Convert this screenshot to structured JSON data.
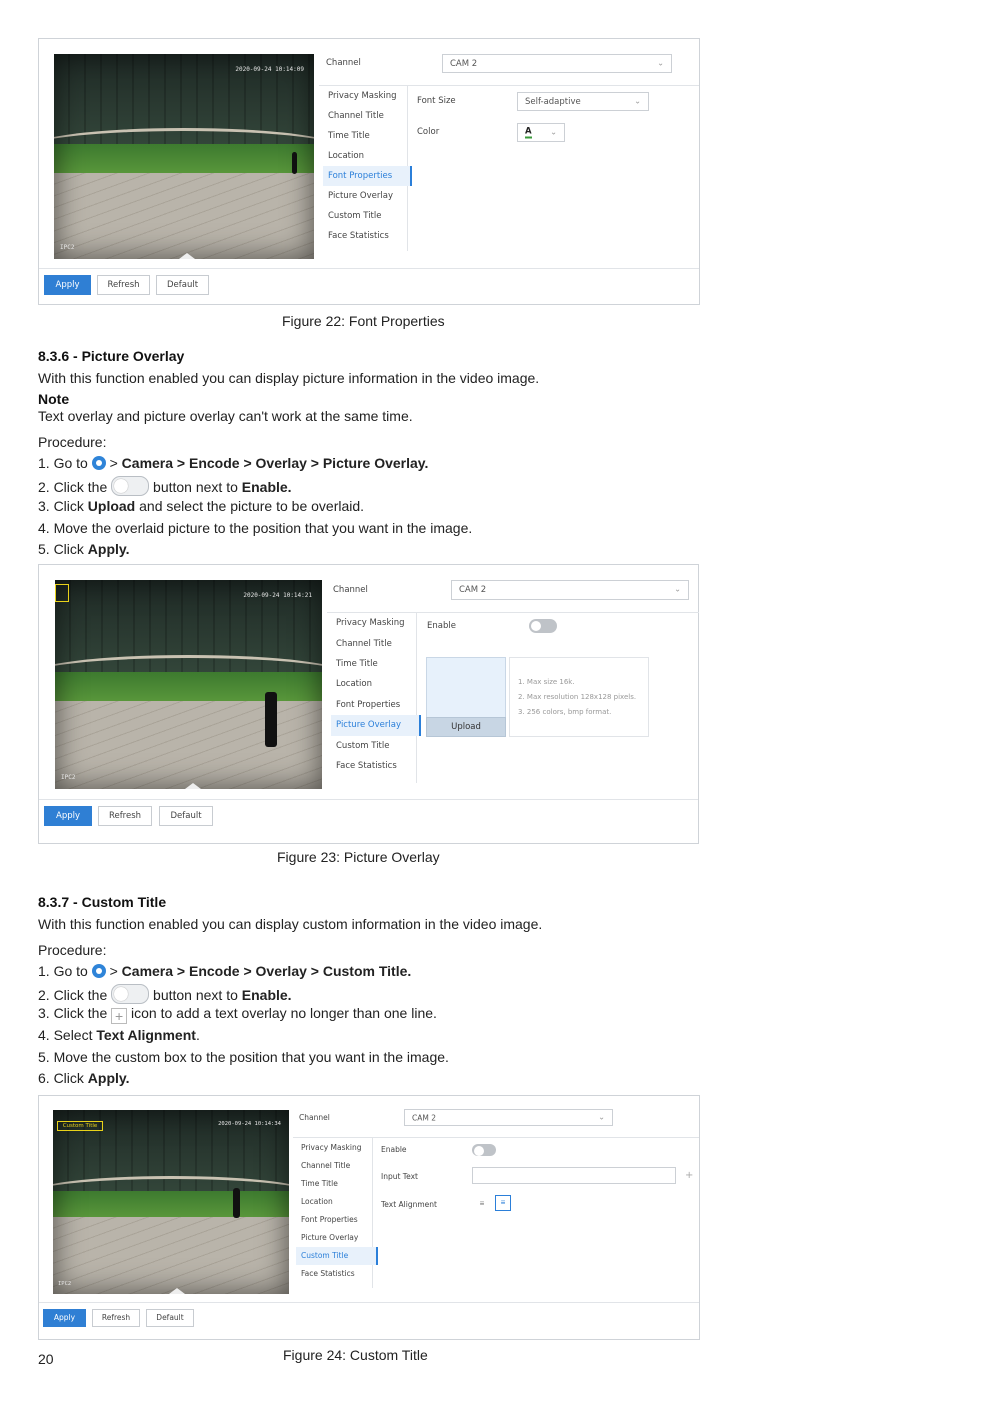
{
  "fig22": {
    "timestamp": "2020-09-24 10:14:09",
    "cam_label": "IPC2",
    "channel_label": "Channel",
    "channel_value": "CAM 2",
    "menu": [
      "Privacy Masking",
      "Channel Title",
      "Time Title",
      "Location",
      "Font Properties",
      "Picture Overlay",
      "Custom Title",
      "Face Statistics"
    ],
    "active": 4,
    "font_size_label": "Font Size",
    "font_size_value": "Self-adaptive",
    "color_label": "Color",
    "color_value": "A",
    "buttons": {
      "apply": "Apply",
      "refresh": "Refresh",
      "default": "Default"
    },
    "caption": "Figure 22: Font Properties"
  },
  "sec836": {
    "heading": "8.3.6 - Picture Overlay",
    "intro": "With this function enabled you can display picture information in the video image.",
    "note_label": "Note",
    "note_text": "Text overlay and picture overlay can't work at the same time.",
    "procedure": "Procedure:",
    "steps": {
      "s1_pre": "1.  Go to ",
      "s1_mid": " > ",
      "s1_bold": "Camera > Encode > Overlay > Picture Overlay.",
      "s2_pre": "2.  Click the ",
      "s2_mid": " button next to ",
      "s2_bold": "Enable.",
      "s3_pre": "3.  Click ",
      "s3_bold": "Upload",
      "s3_post": " and select the picture to be overlaid.",
      "s4": "4.  Move the overlaid picture to the position that you want in the image.",
      "s5_pre": "5.  Click ",
      "s5_bold": "Apply."
    }
  },
  "fig23": {
    "timestamp": "2020-09-24 10:14:21",
    "cam_label": "IPC2",
    "channel_label": "Channel",
    "channel_value": "CAM 2",
    "menu": [
      "Privacy Masking",
      "Channel Title",
      "Time Title",
      "Location",
      "Font Properties",
      "Picture Overlay",
      "Custom Title",
      "Face Statistics"
    ],
    "enable_label": "Enable",
    "upload_label": "Upload",
    "hints": [
      "1. Max size 16k.",
      "2. Max resolution 128x128 pixels.",
      "3. 256 colors, bmp format."
    ],
    "buttons": {
      "apply": "Apply",
      "refresh": "Refresh",
      "default": "Default"
    },
    "caption": "Figure 23: Picture Overlay"
  },
  "sec837": {
    "heading": "8.3.7 - Custom Title",
    "intro": "With this function enabled you can display custom information in the video image.",
    "procedure": "Procedure:",
    "steps": {
      "s1_pre": "1.  Go to ",
      "s1_mid": " > ",
      "s1_bold": "Camera > Encode > Overlay > Custom Title.",
      "s2_pre": "2.  Click the ",
      "s2_mid": " button next to ",
      "s2_bold": "Enable.",
      "s3_pre": "3.  Click the ",
      "s3_post": " icon to add a text overlay no longer than one line.",
      "s4_pre": "4.  Select ",
      "s4_bold": "Text Alignment",
      "s4_post": ".",
      "s5": "5.  Move the custom box to the position that you want in the image.",
      "s6_pre": "6.  Click ",
      "s6_bold": "Apply."
    }
  },
  "fig24": {
    "timestamp": "2020-09-24 10:14:34",
    "custom_title_box": "Custom Title",
    "cam_label": "IPC2",
    "channel_label": "Channel",
    "channel_value": "CAM 2",
    "menu": [
      "Privacy Masking",
      "Channel Title",
      "Time Title",
      "Location",
      "Font Properties",
      "Picture Overlay",
      "Custom Title",
      "Face Statistics"
    ],
    "enable_label": "Enable",
    "input_text_label": "Input Text",
    "input_text_value": "",
    "text_alignment_label": "Text Alignment",
    "buttons": {
      "apply": "Apply",
      "refresh": "Refresh",
      "default": "Default"
    },
    "caption": "Figure 24: Custom Title"
  },
  "page_number": "20"
}
